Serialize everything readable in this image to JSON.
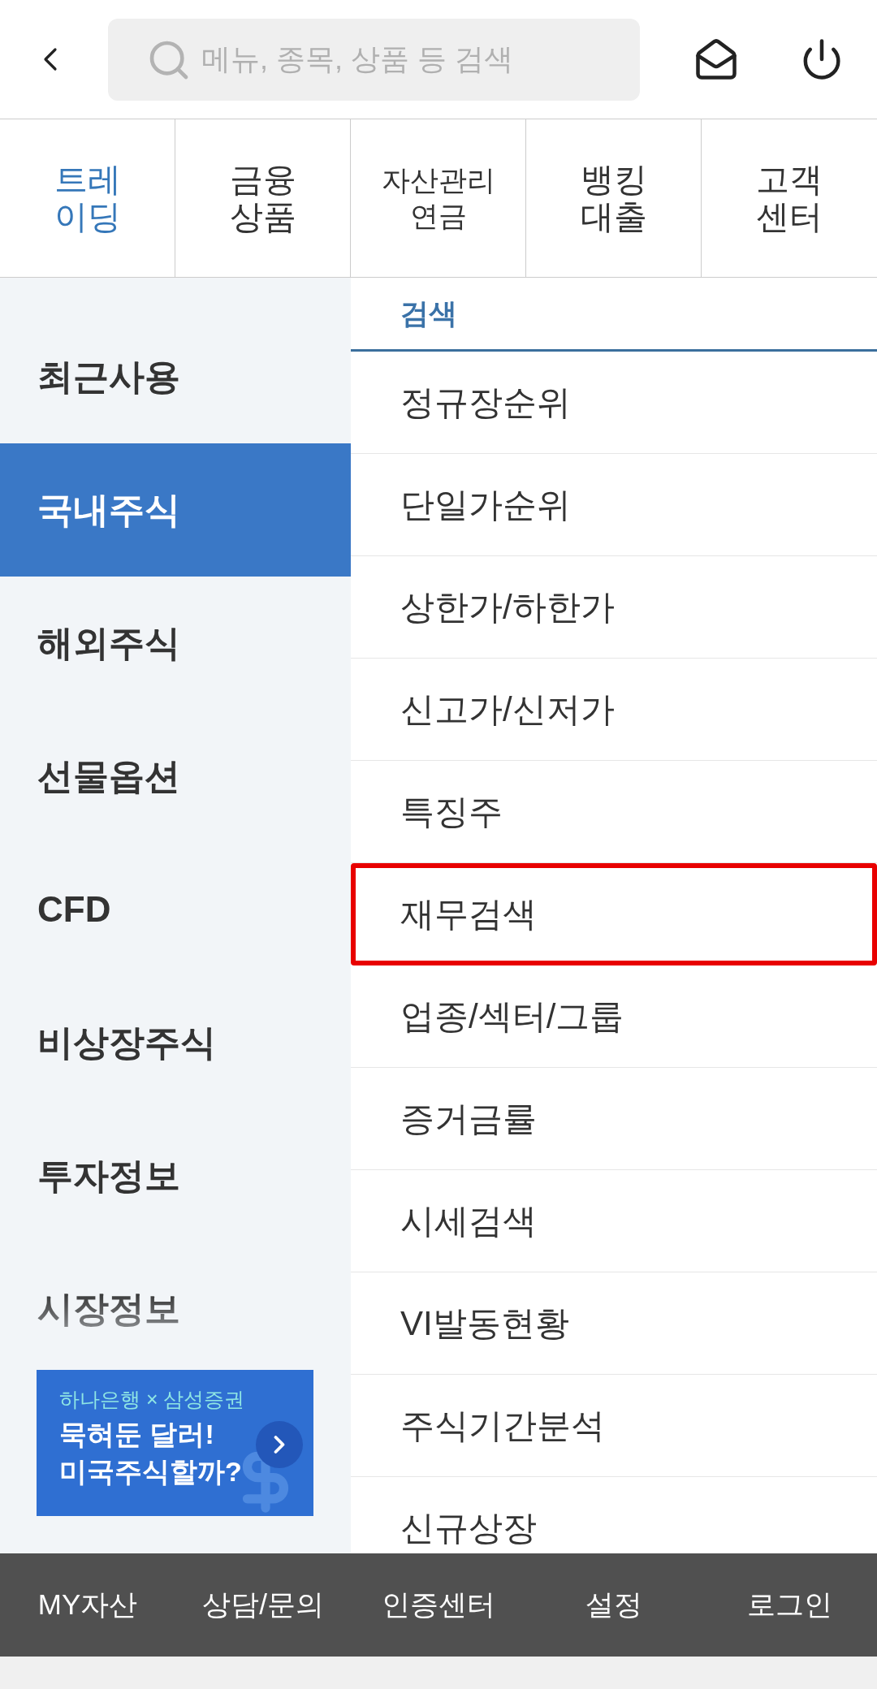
{
  "top_bar": {
    "search": {
      "placeholder": "메뉴, 종목, 상품 등 검색"
    }
  },
  "tabs": [
    {
      "lines": [
        "트레",
        "이딩"
      ],
      "selected": true
    },
    {
      "lines": [
        "금융",
        "상품"
      ],
      "selected": false
    },
    {
      "lines": [
        "자산관리",
        "연금"
      ],
      "selected": false
    },
    {
      "lines": [
        "뱅킹",
        "대출"
      ],
      "selected": false
    },
    {
      "lines": [
        "고객",
        "센터"
      ],
      "selected": false
    }
  ],
  "categories": [
    {
      "label": "최근사용",
      "selected": false
    },
    {
      "label": "국내주식",
      "selected": true
    },
    {
      "label": "해외주식",
      "selected": false
    },
    {
      "label": "선물옵션",
      "selected": false
    },
    {
      "label": "CFD",
      "selected": false
    },
    {
      "label": "비상장주식",
      "selected": false
    },
    {
      "label": "투자정보",
      "selected": false
    },
    {
      "label": "시장정보",
      "selected": false
    }
  ],
  "banner": {
    "caption": "하나은행 × 삼성증권",
    "headline_lines": [
      "묵혀둔 달러!",
      "미국주식할까?"
    ]
  },
  "submenu": {
    "heading": "검색",
    "items": [
      {
        "label": "정규장순위",
        "highlighted": false
      },
      {
        "label": "단일가순위",
        "highlighted": false
      },
      {
        "label": "상한가/하한가",
        "highlighted": false
      },
      {
        "label": "신고가/신저가",
        "highlighted": false
      },
      {
        "label": "특징주",
        "highlighted": false
      },
      {
        "label": "재무검색",
        "highlighted": true
      },
      {
        "label": "업종/섹터/그룹",
        "highlighted": false
      },
      {
        "label": "증거금률",
        "highlighted": false
      },
      {
        "label": "시세검색",
        "highlighted": false
      },
      {
        "label": "VI발동현황",
        "highlighted": false
      },
      {
        "label": "주식기간분석",
        "highlighted": false
      },
      {
        "label": "신규상장",
        "highlighted": false
      }
    ]
  },
  "bottom_bar": [
    "MY자산",
    "상담/문의",
    "인증센터",
    "설정",
    "로그인"
  ]
}
